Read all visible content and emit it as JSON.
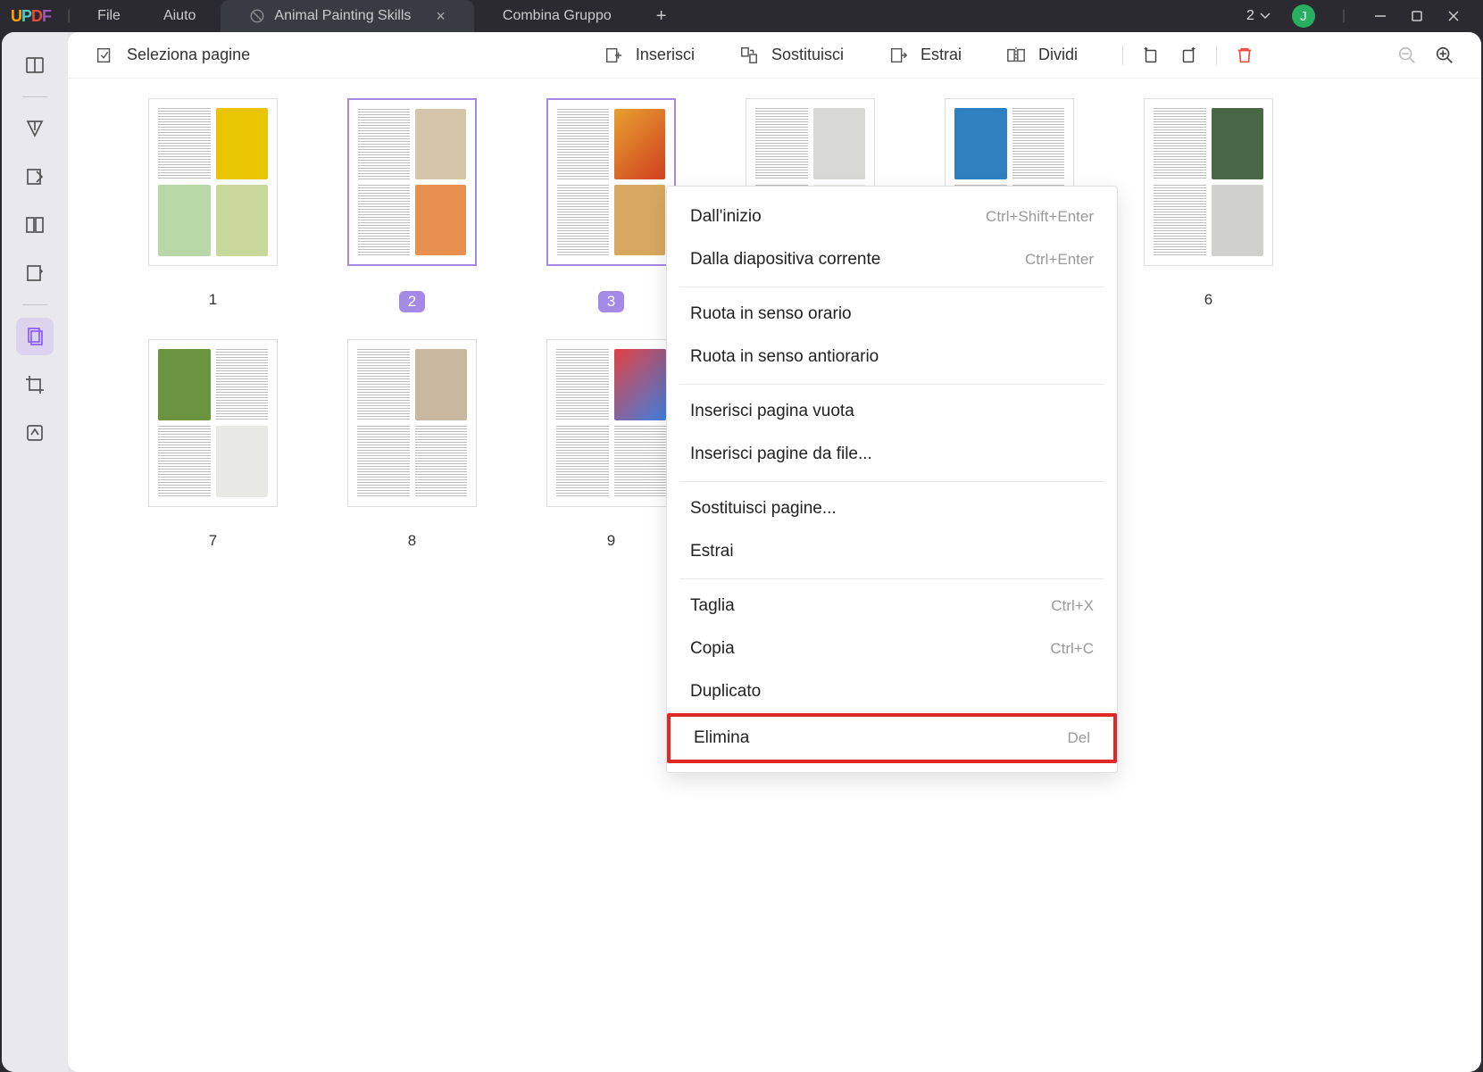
{
  "titlebar": {
    "file": "File",
    "help": "Aiuto",
    "active_tab": "Animal Painting Skills",
    "inactive_tab": "Combina Gruppo",
    "badge": "2",
    "avatar": "J"
  },
  "toolbar": {
    "select": "Seleziona pagine",
    "insert": "Inserisci",
    "replace": "Sostituisci",
    "extract": "Estrai",
    "split": "Dividi"
  },
  "pages": {
    "nums": [
      "1",
      "2",
      "3",
      "6",
      "7",
      "8",
      "9"
    ]
  },
  "ctx": {
    "from_start": "Dall'inizio",
    "from_start_key": "Ctrl+Shift+Enter",
    "from_current": "Dalla diapositiva corrente",
    "from_current_key": "Ctrl+Enter",
    "rotate_cw": "Ruota in senso orario",
    "rotate_ccw": "Ruota in senso antiorario",
    "insert_blank": "Inserisci pagina vuota",
    "insert_file": "Inserisci pagine da file...",
    "replace_pages": "Sostituisci pagine...",
    "extract": "Estrai",
    "cut": "Taglia",
    "cut_key": "Ctrl+X",
    "copy": "Copia",
    "copy_key": "Ctrl+C",
    "duplicate": "Duplicato",
    "delete": "Elimina",
    "delete_key": "Del"
  }
}
